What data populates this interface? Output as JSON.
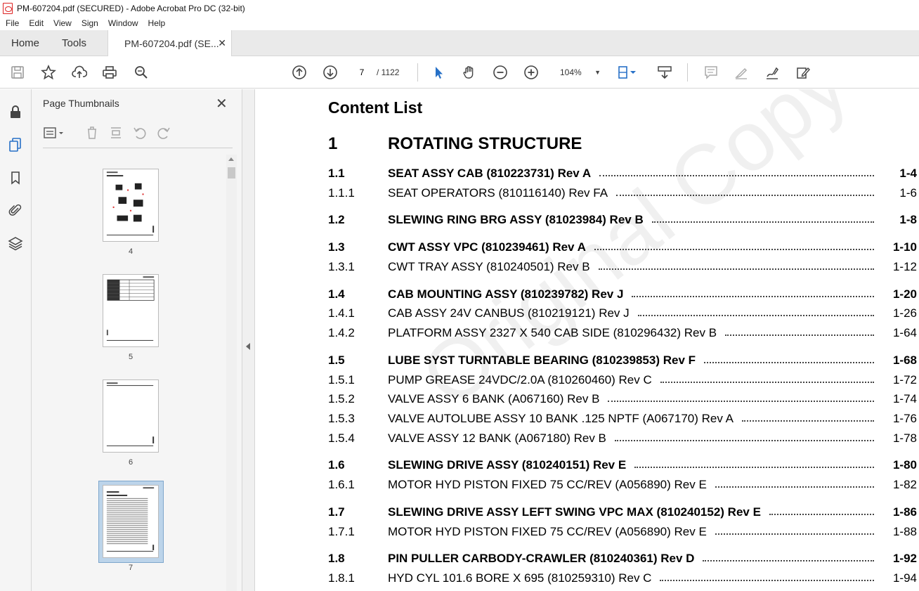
{
  "window": {
    "title": "PM-607204.pdf (SECURED) - Adobe Acrobat Pro DC (32-bit)"
  },
  "menu": [
    "File",
    "Edit",
    "View",
    "Sign",
    "Window",
    "Help"
  ],
  "tabs": {
    "home": "Home",
    "tools": "Tools",
    "document": "PM-607204.pdf (SE..."
  },
  "toolbar": {
    "page_current": "7",
    "page_total": "/ 1122",
    "zoom": "104%",
    "icons": [
      "save-icon",
      "bookmark-star-icon",
      "upload-icon",
      "print-icon",
      "find-icon",
      "prev-page-icon",
      "next-page-icon",
      "select-cursor-icon",
      "hand-icon",
      "zoom-out-icon",
      "zoom-in-icon",
      "fit-page-icon",
      "scroll-mode-icon",
      "comment-icon",
      "highlight-icon",
      "sign-icon",
      "edit-pdf-icon"
    ]
  },
  "thumbnails": {
    "panel_title": "Page Thumbnails",
    "pages": [
      {
        "num": "4"
      },
      {
        "num": "5"
      },
      {
        "num": "6"
      },
      {
        "num": "7",
        "selected": true
      }
    ]
  },
  "document": {
    "heading": "Content List",
    "watermark": "Original Copy",
    "entries": [
      {
        "num": "1",
        "label": "ROTATING STRUCTURE",
        "page": "",
        "style": "major"
      },
      {
        "num": "1.1",
        "label": "SEAT ASSY CAB (810223731) Rev A",
        "page": "1-4",
        "style": "bold"
      },
      {
        "num": "1.1.1",
        "label": "SEAT OPERATORS (810116140) Rev FA",
        "page": "1-6",
        "style": "normal"
      },
      {
        "num": "1.2",
        "label": "SLEWING RING BRG ASSY (81023984) Rev B",
        "page": "1-8",
        "style": "bold"
      },
      {
        "num": "1.3",
        "label": "CWT ASSY VPC (810239461) Rev A",
        "page": "1-10",
        "style": "bold"
      },
      {
        "num": "1.3.1",
        "label": "CWT TRAY ASSY (810240501) Rev B",
        "page": "1-12",
        "style": "normal"
      },
      {
        "num": "1.4",
        "label": "CAB MOUNTING ASSY (810239782) Rev J",
        "page": "1-20",
        "style": "bold"
      },
      {
        "num": "1.4.1",
        "label": "CAB ASSY 24V CANBUS (810219121) Rev J",
        "page": "1-26",
        "style": "normal"
      },
      {
        "num": "1.4.2",
        "label": "PLATFORM ASSY 2327 X 540 CAB SIDE (810296432) Rev B",
        "page": "1-64",
        "style": "normal"
      },
      {
        "num": "1.5",
        "label": "LUBE SYST TURNTABLE BEARING (810239853) Rev F",
        "page": "1-68",
        "style": "bold"
      },
      {
        "num": "1.5.1",
        "label": "PUMP GREASE 24VDC/2.0A (810260460) Rev C",
        "page": "1-72",
        "style": "normal"
      },
      {
        "num": "1.5.2",
        "label": "VALVE ASSY 6 BANK (A067160) Rev B",
        "page": "1-74",
        "style": "normal"
      },
      {
        "num": "1.5.3",
        "label": "VALVE AUTOLUBE ASSY 10 BANK .125 NPTF (A067170) Rev A",
        "page": "1-76",
        "style": "normal"
      },
      {
        "num": "1.5.4",
        "label": "VALVE ASSY 12 BANK (A067180) Rev B",
        "page": "1-78",
        "style": "normal"
      },
      {
        "num": "1.6",
        "label": "SLEWING DRIVE ASSY (810240151) Rev E",
        "page": "1-80",
        "style": "bold"
      },
      {
        "num": "1.6.1",
        "label": "MOTOR HYD PISTON FIXED 75 CC/REV (A056890) Rev E",
        "page": "1-82",
        "style": "normal"
      },
      {
        "num": "1.7",
        "label": "SLEWING DRIVE ASSY LEFT SWING VPC MAX (810240152) Rev E",
        "page": "1-86",
        "style": "bold"
      },
      {
        "num": "1.7.1",
        "label": "MOTOR HYD PISTON FIXED 75 CC/REV (A056890) Rev E",
        "page": "1-88",
        "style": "normal"
      },
      {
        "num": "1.8",
        "label": "PIN PULLER CARBODY-CRAWLER (810240361) Rev D",
        "page": "1-92",
        "style": "bold"
      },
      {
        "num": "1.8.1",
        "label": "HYD CYL 101.6 BORE X 695 (810259310) Rev C",
        "page": "1-94",
        "style": "normal"
      }
    ]
  }
}
